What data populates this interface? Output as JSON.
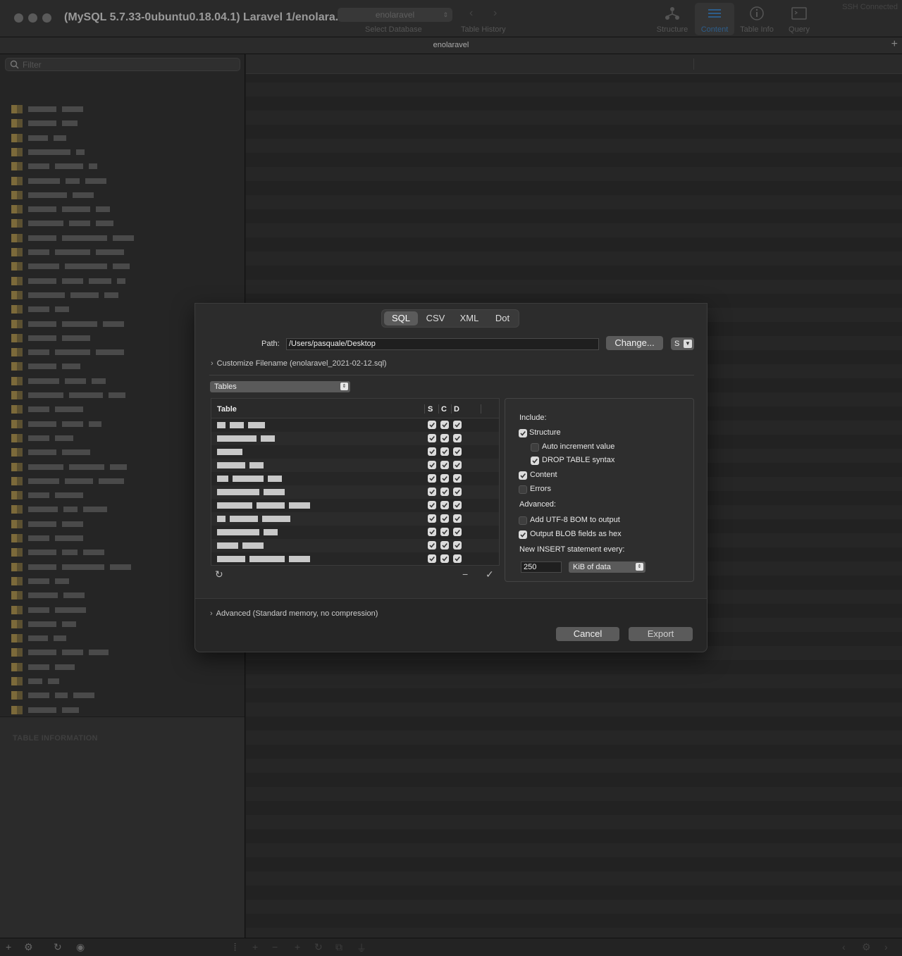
{
  "window": {
    "title": "(MySQL 5.7.33-0ubuntu0.18.04.1) Laravel 1/enolara...",
    "status": "SSH Connected"
  },
  "toolbar": {
    "database_value": "enolaravel",
    "select_database_label": "Select Database",
    "table_history_label": "Table History",
    "buttons": [
      {
        "label": "Structure",
        "icon": "structure-icon"
      },
      {
        "label": "Content",
        "icon": "content-icon",
        "active": true
      },
      {
        "label": "Table Info",
        "icon": "info-icon"
      },
      {
        "label": "Query",
        "icon": "query-icon"
      }
    ]
  },
  "tabstrip": {
    "tab_name": "enolaravel"
  },
  "sidebar": {
    "filter_placeholder": "Filter",
    "table_info_heading": "TABLE INFORMATION"
  },
  "export_sheet": {
    "formats": [
      "SQL",
      "CSV",
      "XML",
      "Dot"
    ],
    "selected_format": "SQL",
    "path_label": "Path:",
    "path_value": "/Users/pasquale/Desktop",
    "change_button": "Change...",
    "encoding_value": "S",
    "customize_filename": "Customize Filename (enolaravel_2021-02-12.sql)",
    "scope_select": "Tables",
    "table_columns": [
      "Table",
      "S",
      "C",
      "D"
    ],
    "include_label": "Include:",
    "options": {
      "structure": {
        "label": "Structure",
        "checked": true
      },
      "auto_increment": {
        "label": "Auto increment value",
        "checked": false
      },
      "drop_table": {
        "label": "DROP TABLE syntax",
        "checked": true
      },
      "content": {
        "label": "Content",
        "checked": true
      },
      "errors": {
        "label": "Errors",
        "checked": false
      }
    },
    "advanced_label": "Advanced:",
    "advanced_options": {
      "utf8_bom": {
        "label": "Add UTF-8 BOM to output",
        "checked": false
      },
      "blob_hex": {
        "label": "Output BLOB fields as hex",
        "checked": true
      }
    },
    "insert_label": "New INSERT statement every:",
    "insert_value": "250",
    "insert_unit": "KiB of data",
    "advanced_disclosure": "Advanced (Standard memory, no compression)",
    "cancel_button": "Cancel",
    "export_button": "Export"
  }
}
